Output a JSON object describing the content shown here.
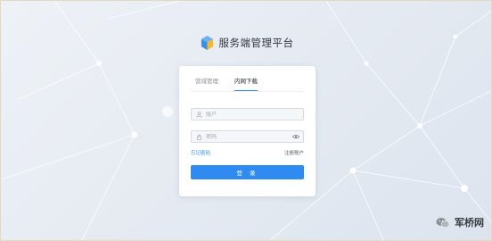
{
  "app": {
    "title": "服务端管理平台"
  },
  "login": {
    "tabs": [
      {
        "label": "营域管理"
      },
      {
        "label": "内网下载"
      }
    ],
    "active_tab": 1,
    "username_placeholder": "账户",
    "password_placeholder": "密码",
    "forgot_label": "忘记密码",
    "register_label": "注册账户",
    "submit_label": "登 录"
  },
  "watermark": {
    "text": "军桥网"
  },
  "colors": {
    "accent": "#2e8bf0",
    "logo_blue": "#3a8ee6",
    "logo_yellow": "#f5b82e"
  },
  "icons": {
    "logo": "cube-logo-icon",
    "user": "user-icon",
    "lock": "lock-icon",
    "eye": "eye-icon",
    "watermark": "wechat-icon"
  }
}
